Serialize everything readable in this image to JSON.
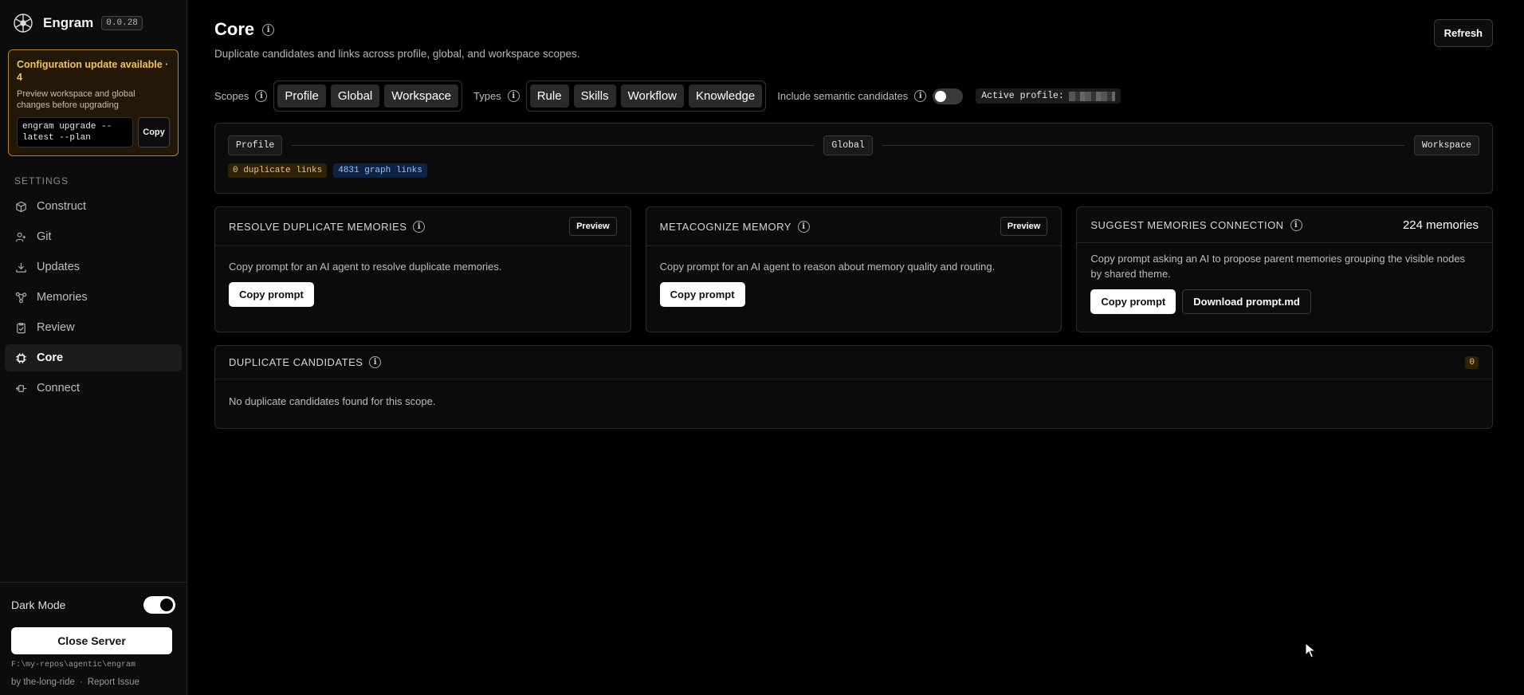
{
  "sidebar": {
    "app_name": "Engram",
    "version": "0.0.28",
    "update": {
      "title": "Configuration update available · 4",
      "description": "Preview workspace and global changes before upgrading",
      "command": "engram upgrade --\nlatest --plan",
      "copy_label": "Copy"
    },
    "section_label": "SETTINGS",
    "items": [
      {
        "label": "Construct",
        "icon": "cube-icon"
      },
      {
        "label": "Git",
        "icon": "git-icon"
      },
      {
        "label": "Updates",
        "icon": "download-icon"
      },
      {
        "label": "Memories",
        "icon": "graph-icon"
      },
      {
        "label": "Review",
        "icon": "clipboard-icon"
      },
      {
        "label": "Core",
        "icon": "core-icon",
        "active": true
      },
      {
        "label": "Connect",
        "icon": "plug-icon"
      }
    ],
    "dark_mode_label": "Dark Mode",
    "dark_mode_on": true,
    "close_server_label": "Close Server",
    "path": "F:\\my-repos\\agentic\\engram",
    "byline": "by the-long-ride",
    "separator": "·",
    "report_issue": "Report Issue"
  },
  "header": {
    "title": "Core",
    "subtitle": "Duplicate candidates and links across profile, global, and workspace scopes.",
    "refresh_label": "Refresh"
  },
  "filters": {
    "scopes_label": "Scopes",
    "scopes": [
      "Profile",
      "Global",
      "Workspace"
    ],
    "types_label": "Types",
    "types": [
      "Rule",
      "Skills",
      "Workflow",
      "Knowledge"
    ],
    "semantic_label": "Include semantic candidates",
    "semantic_on": false,
    "active_profile_label": "Active profile:"
  },
  "scope_panel": {
    "left": "Profile",
    "middle": "Global",
    "right": "Workspace",
    "duplicate_links": "0 duplicate links",
    "graph_links": "4831 graph links"
  },
  "cards": [
    {
      "title": "RESOLVE DUPLICATE MEMORIES",
      "preview_label": "Preview",
      "description": "Copy prompt for an AI agent to resolve duplicate memories.",
      "primary_label": "Copy prompt"
    },
    {
      "title": "METACOGNIZE MEMORY",
      "preview_label": "Preview",
      "description": "Copy prompt for an AI agent to reason about memory quality and routing.",
      "primary_label": "Copy prompt"
    },
    {
      "title": "SUGGEST MEMORIES CONNECTION",
      "count": "224 memories",
      "description": "Copy prompt asking an AI to propose parent memories grouping the visible nodes by shared theme.",
      "primary_label": "Copy prompt",
      "secondary_label": "Download prompt.md"
    }
  ],
  "duplicates": {
    "title": "DUPLICATE CANDIDATES",
    "count": "0",
    "empty_text": "No duplicate candidates found for this scope."
  },
  "colors": {
    "accent_amber": "#f5c15c",
    "accent_blue": "#9bc1ff",
    "background": "#000000"
  }
}
